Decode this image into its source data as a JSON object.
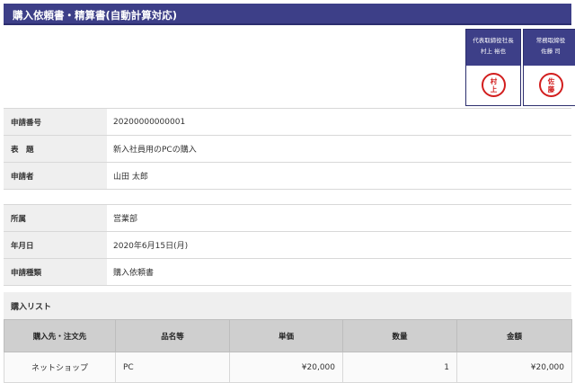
{
  "header": {
    "title": "購入依頼書・精算書(自動計算対応)"
  },
  "approvals": [
    {
      "role": "代表取締役社長",
      "name": "村上 裕也",
      "seal": [
        "村",
        "上"
      ]
    },
    {
      "role": "常務取締役",
      "name": "佐藤 司",
      "seal": [
        "佐",
        "藤"
      ]
    }
  ],
  "fields_top": [
    {
      "label": "申請番号",
      "value": "20200000000001"
    },
    {
      "label": "表　題",
      "value": "新入社員用のPCの購入"
    },
    {
      "label": "申請者",
      "value": "山田 太郎"
    }
  ],
  "fields_bottom": [
    {
      "label": "所属",
      "value": "営業部"
    },
    {
      "label": "年月日",
      "value": "2020年6月15日(月)"
    },
    {
      "label": "申請種類",
      "value": "購入依頼書"
    }
  ],
  "purchase_list": {
    "title": "購入リスト",
    "columns": [
      "購入先・注文先",
      "品名等",
      "単価",
      "数量",
      "金額"
    ],
    "rows": [
      {
        "vendor": "ネットショップ",
        "item": "PC",
        "unit_price": "¥20,000",
        "qty": "1",
        "amount": "¥20,000"
      }
    ]
  }
}
